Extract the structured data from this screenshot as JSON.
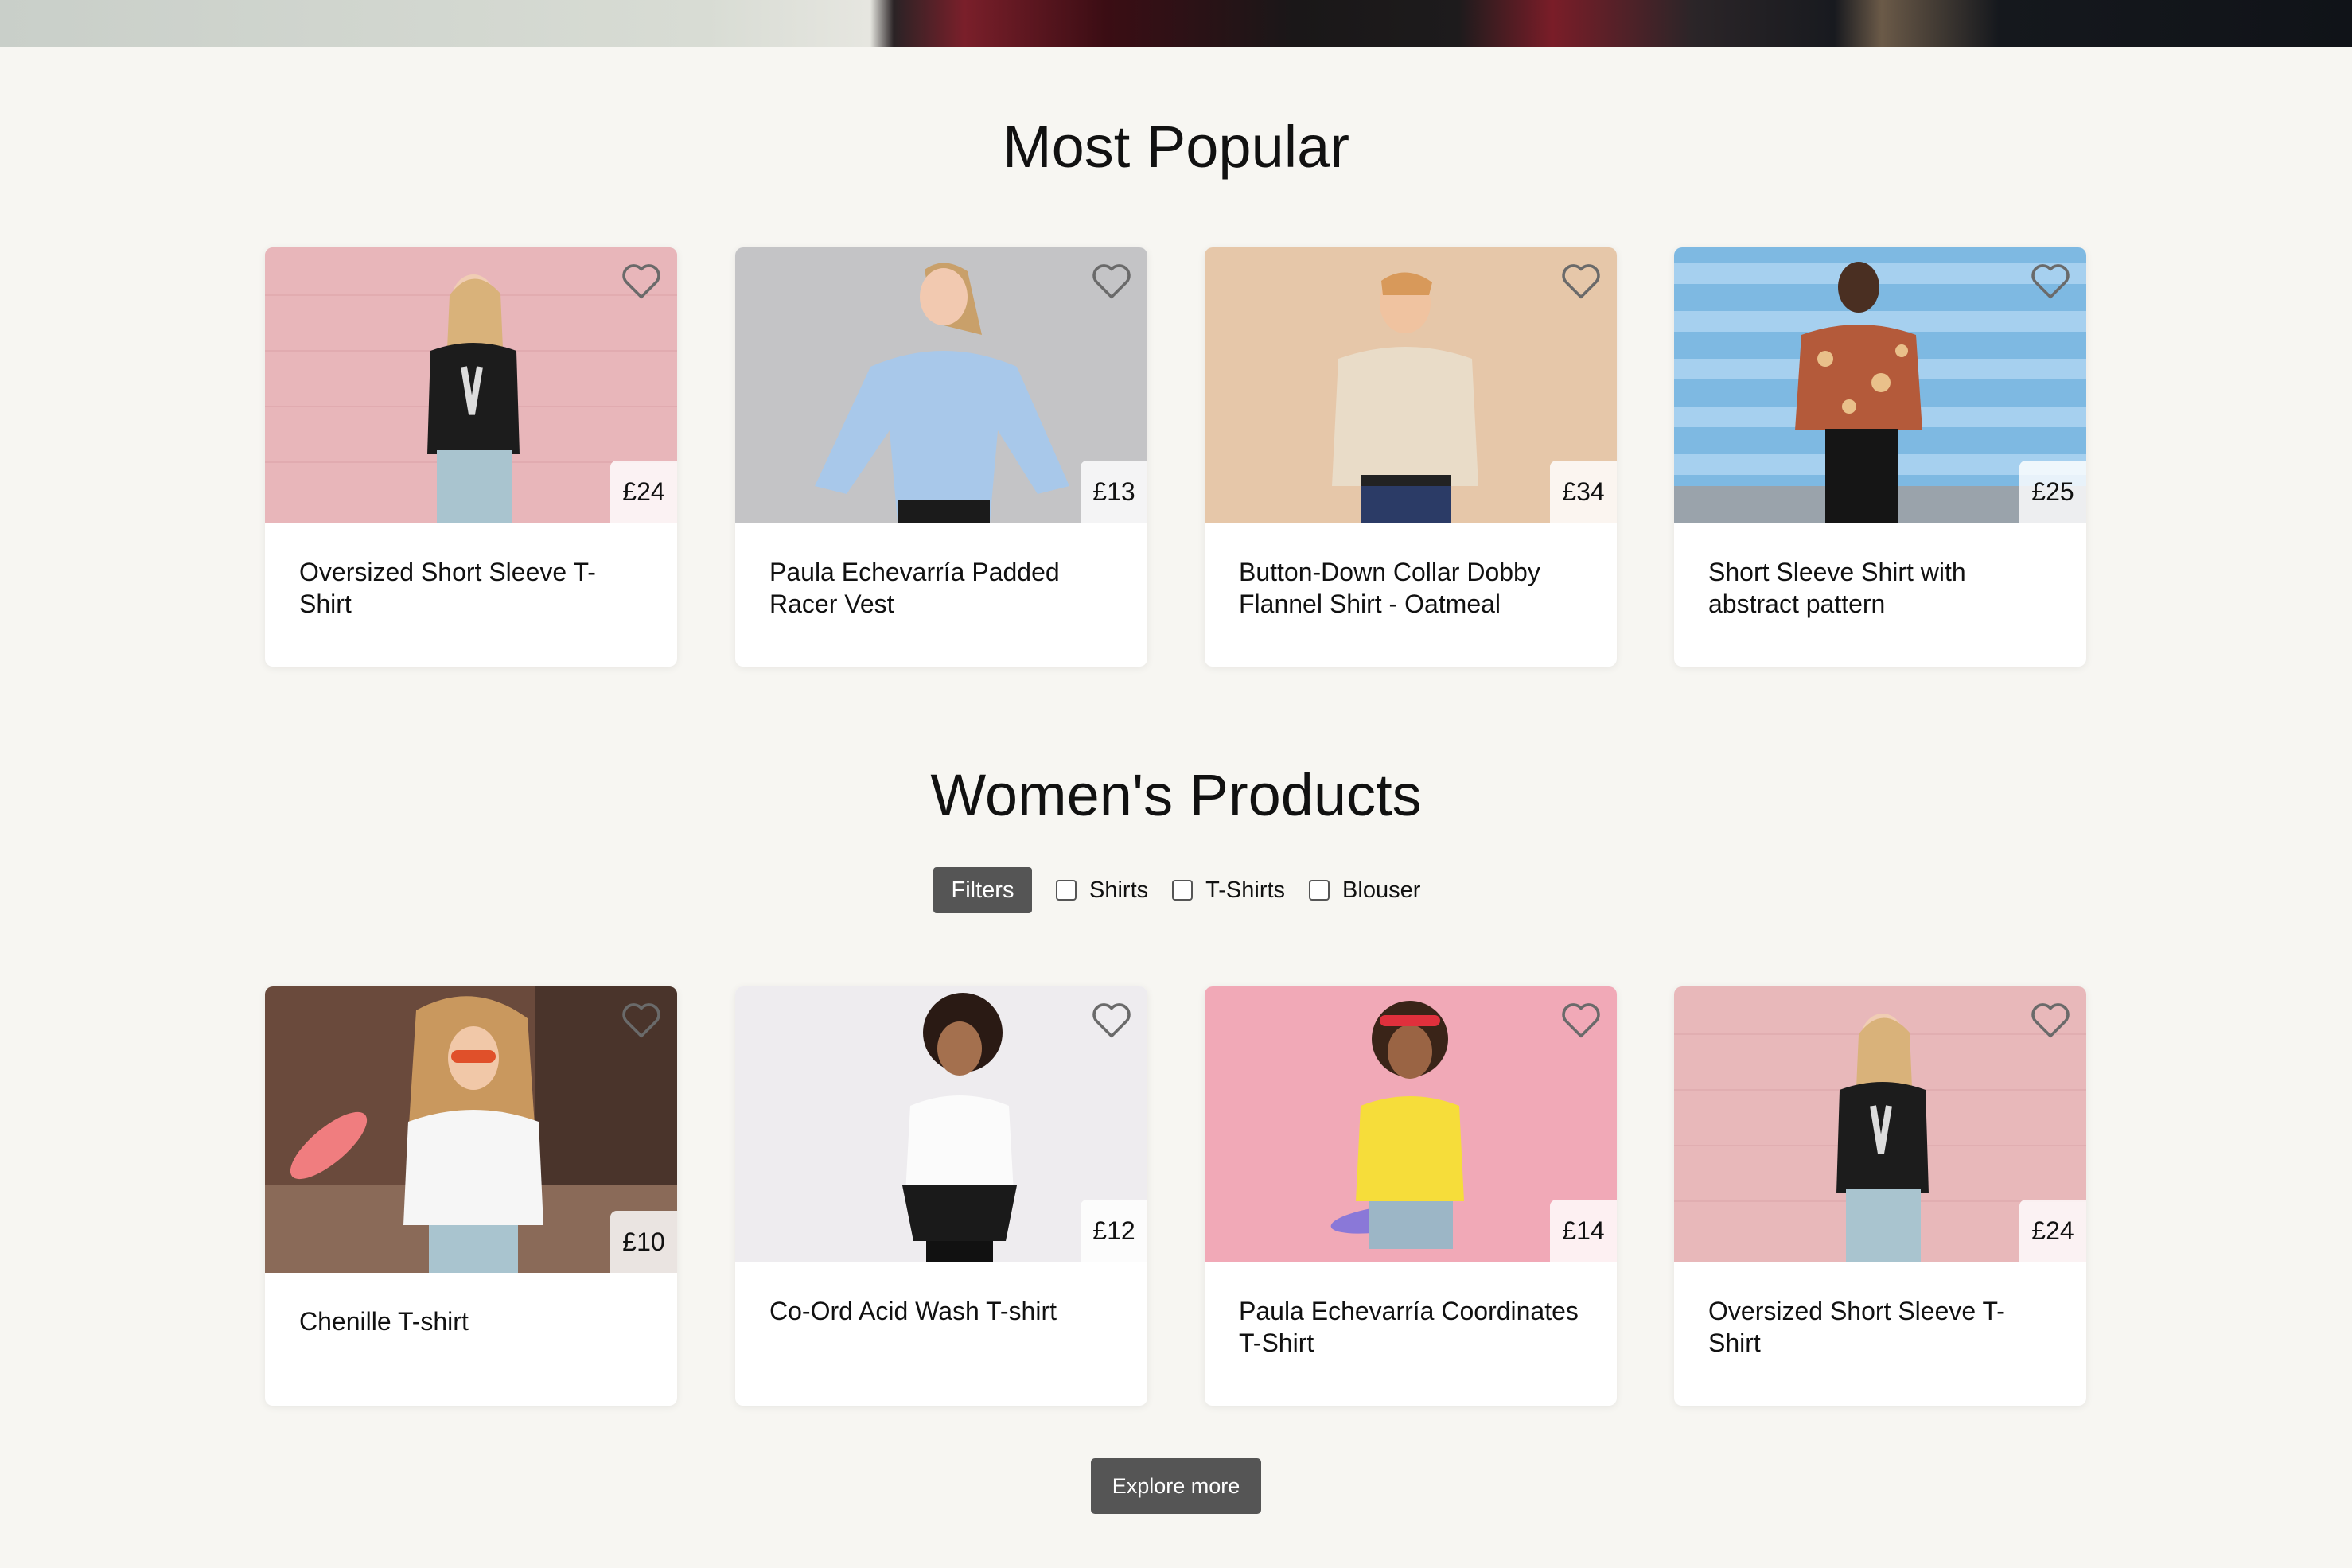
{
  "sections": {
    "popular_title": "Most Popular",
    "women_title": "Women's Products"
  },
  "popular": [
    {
      "name": "Oversized Short Sleeve T-Shirt",
      "price": "£24"
    },
    {
      "name": "Paula Echevarría Padded Racer Vest",
      "price": "£13"
    },
    {
      "name": "Button-Down Collar Dobby Flannel Shirt - Oatmeal",
      "price": "£34"
    },
    {
      "name": "Short Sleeve Shirt with abstract pattern",
      "price": "£25"
    }
  ],
  "filters": {
    "button_label": "Filters",
    "options": [
      "Shirts",
      "T-Shirts",
      "Blouser"
    ]
  },
  "women": [
    {
      "name": "Chenille T-shirt",
      "price": "£10"
    },
    {
      "name": "Co-Ord Acid Wash T-shirt",
      "price": "£12"
    },
    {
      "name": "Paula Echevarría Coordinates T-Shirt",
      "price": "£14"
    },
    {
      "name": "Oversized Short Sleeve T-Shirt",
      "price": "£24"
    }
  ],
  "explore_label": "Explore more",
  "colors": {
    "page_bg": "#f7f6f2",
    "button_bg": "#555555",
    "photo_bgs": [
      "#e6b4b8",
      "#c4c4c6",
      "#e6c7a9",
      "#7eb9e2",
      "#6a4a3c",
      "#eeecef",
      "#f1a9b7",
      "#e8b8ba"
    ]
  }
}
